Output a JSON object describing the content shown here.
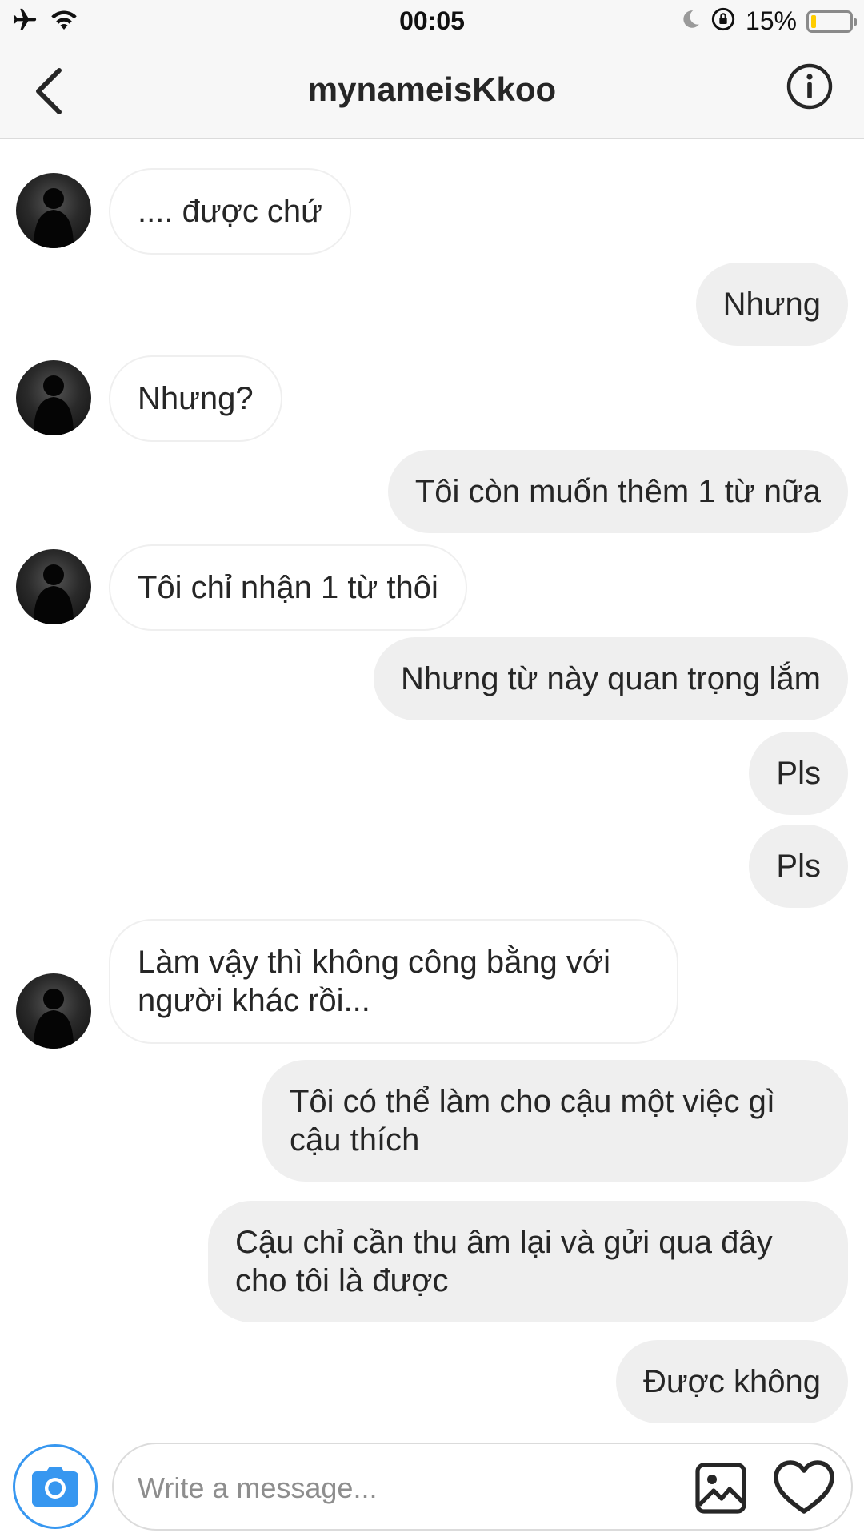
{
  "status_bar": {
    "time": "00:05",
    "battery_percent": "15%",
    "battery_level": 0.15,
    "icons": [
      "airplane-icon",
      "wifi-icon",
      "moon-icon",
      "rotation-lock-icon",
      "battery-icon"
    ]
  },
  "header": {
    "title": "mynameisKkoo",
    "back_icon": "chevron-left-icon",
    "info_icon": "info-icon"
  },
  "messages": [
    {
      "side": "in",
      "avatar": true,
      "text": ".... được chứ"
    },
    {
      "side": "out",
      "text": "Nhưng"
    },
    {
      "side": "in",
      "avatar": true,
      "text": "Nhưng?"
    },
    {
      "side": "out",
      "text": "Tôi còn muốn thêm 1 từ nữa"
    },
    {
      "side": "in",
      "avatar": true,
      "text": "Tôi chỉ nhận 1 từ thôi"
    },
    {
      "side": "out",
      "text": "Nhưng từ này quan trọng lắm"
    },
    {
      "side": "out",
      "text": "Pls"
    },
    {
      "side": "out",
      "text": "Pls"
    },
    {
      "side": "in",
      "avatar": true,
      "text": "Làm vậy thì không công bằng với người khác rồi..."
    },
    {
      "side": "out",
      "text": "Tôi có thể làm cho cậu một việc gì cậu thích"
    },
    {
      "side": "out",
      "text": "Cậu chỉ cần thu âm lại và gửi qua đây cho tôi là được"
    },
    {
      "side": "out",
      "text": "Được không"
    }
  ],
  "composer": {
    "placeholder": "Write a message...",
    "camera_icon": "camera-icon",
    "gallery_icon": "image-gallery-icon",
    "like_icon": "heart-icon",
    "accent_color": "#3797f0"
  }
}
